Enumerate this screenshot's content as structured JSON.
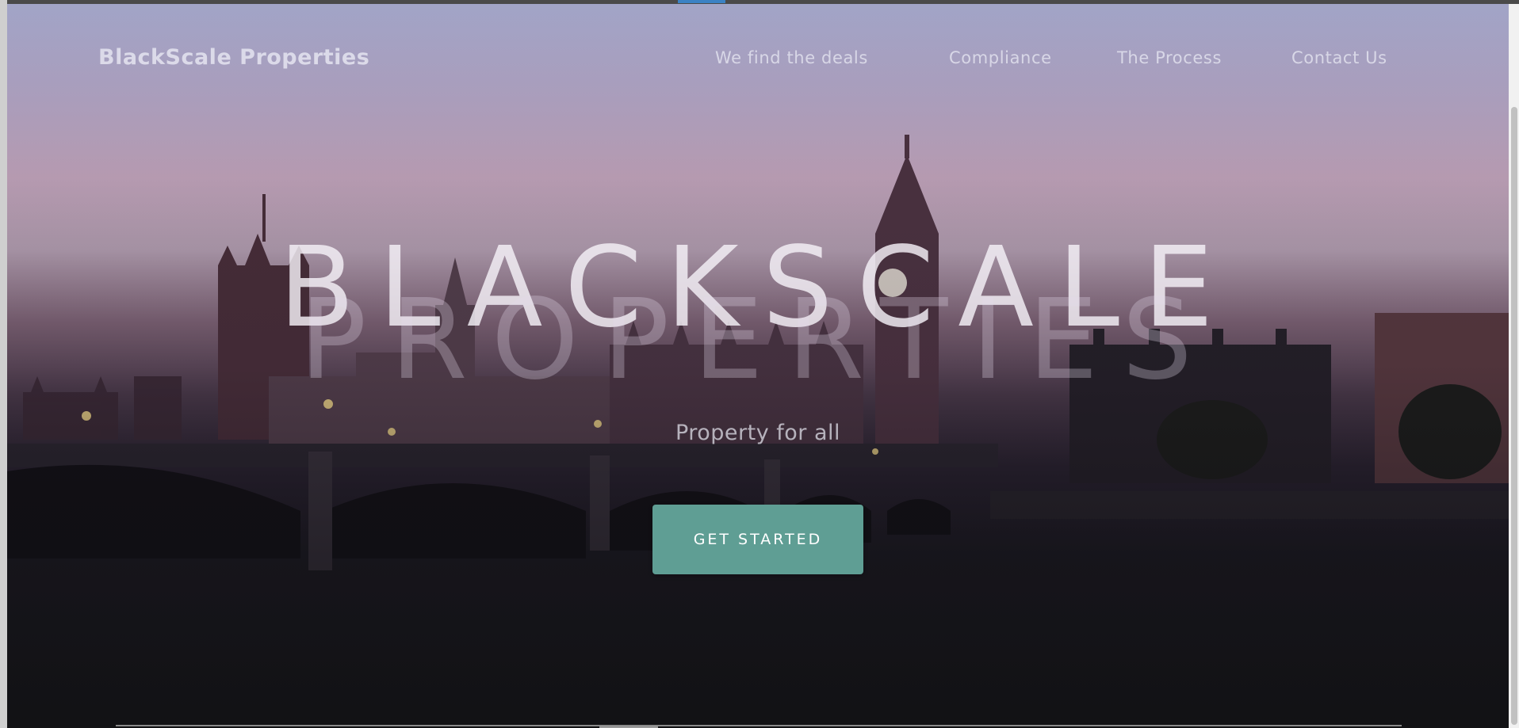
{
  "nav": {
    "brand": "BlackScale Properties",
    "links": [
      "We find the deals",
      "Compliance",
      "The Process",
      "Contact Us"
    ]
  },
  "hero": {
    "title_line1": "BLACKSCALE",
    "title_line2": "PROPERTIES",
    "tagline": "Property for all",
    "cta_label": "GET STARTED"
  },
  "colors": {
    "cta_background": "#5f9e94",
    "sky_top": "#a9acd0",
    "sky_pink": "#c7a9c0",
    "water": "#1a1a1c"
  },
  "background_image": "london-westminster-skyline-dusk"
}
